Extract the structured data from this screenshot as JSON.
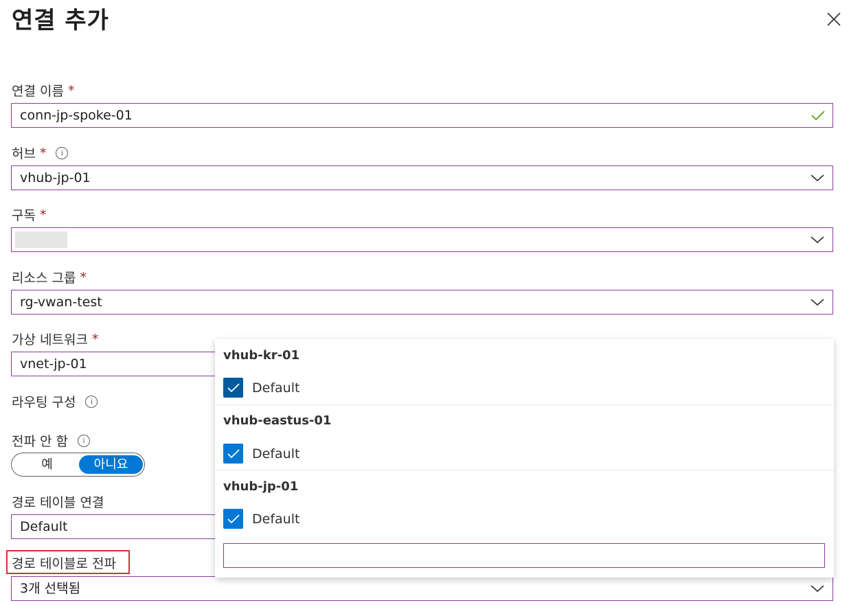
{
  "panel": {
    "title": "연결 추가"
  },
  "form": {
    "required_marker": "*",
    "info_glyph": "i",
    "connection_name": {
      "label": "연결 이름",
      "value": "conn-jp-spoke-01"
    },
    "hub": {
      "label": "허브",
      "value": "vhub-jp-01"
    },
    "subscription": {
      "label": "구독",
      "value": ""
    },
    "resource_group": {
      "label": "리소스 그룹",
      "value": "rg-vwan-test"
    },
    "virtual_network": {
      "label": "가상 네트워크",
      "value": "vnet-jp-01"
    },
    "routing_config": {
      "label": "라우팅 구성"
    },
    "propagate_none": {
      "label": "전파 안 함",
      "options": [
        "예",
        "아니요"
      ],
      "selected": "아니요"
    },
    "associate_route_table": {
      "label": "경로 테이블 연결",
      "value": "Default"
    },
    "propagate_route_tables": {
      "label": "경로 테이블로 전파",
      "value": "3개 선택됨"
    }
  },
  "dropdown": {
    "groups": [
      {
        "hub": "vhub-kr-01",
        "option": "Default",
        "checked": true
      },
      {
        "hub": "vhub-eastus-01",
        "option": "Default",
        "checked": true
      },
      {
        "hub": "vhub-jp-01",
        "option": "Default",
        "checked": true
      }
    ],
    "filter_value": ""
  },
  "colors": {
    "accent": "#0078d4",
    "required": "#a4262c",
    "field_border": "#8a3a9e",
    "highlight": "#d13438",
    "valid_check": "#57a300"
  },
  "icons": [
    "close-icon",
    "checkmark-icon",
    "chevron-down-icon",
    "info-icon",
    "checkbox-checked-icon"
  ]
}
